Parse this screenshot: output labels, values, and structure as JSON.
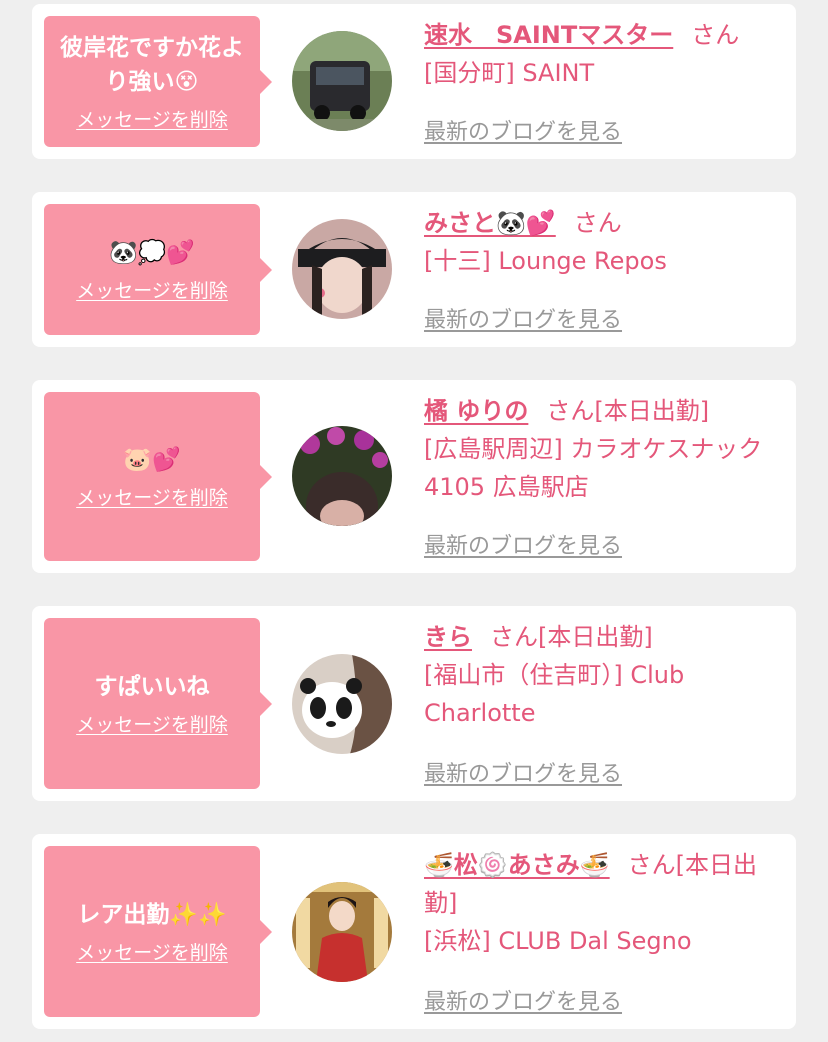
{
  "accent_color": "#e4577a",
  "bubble_color": "#f996a6",
  "items": [
    {
      "message": "彼岸花ですか花より強い😵",
      "delete_label": "メッセージを削除",
      "name": "速水　SAINTマスター",
      "honorific": "さん",
      "status": "",
      "shop": "[国分町] SAINT",
      "blog_label": "最新のブログを見る"
    },
    {
      "message": "🐼💭💕",
      "delete_label": "メッセージを削除",
      "name": "みさと🐼💕",
      "honorific": "さん",
      "status": "",
      "shop": "[十三] Lounge Repos",
      "blog_label": "最新のブログを見る"
    },
    {
      "message": "🐷💕",
      "delete_label": "メッセージを削除",
      "name": "橘 ゆりの",
      "honorific": "さん",
      "status": "[本日出勤]",
      "shop": "[広島駅周辺] カラオケスナック 4105 広島駅店",
      "blog_label": "最新のブログを見る"
    },
    {
      "message": "すぱいいね",
      "delete_label": "メッセージを削除",
      "name": "きら",
      "honorific": "さん",
      "status": "[本日出勤]",
      "shop": "[福山市（住吉町）] Club Charlotte",
      "blog_label": "最新のブログを見る"
    },
    {
      "message": "レア出勤✨✨",
      "delete_label": "メッセージを削除",
      "name": "🍜松🍥あさみ🍜",
      "honorific": "さん",
      "status": "[本日出勤]",
      "shop": "[浜松] CLUB Dal Segno",
      "blog_label": "最新のブログを見る"
    }
  ]
}
